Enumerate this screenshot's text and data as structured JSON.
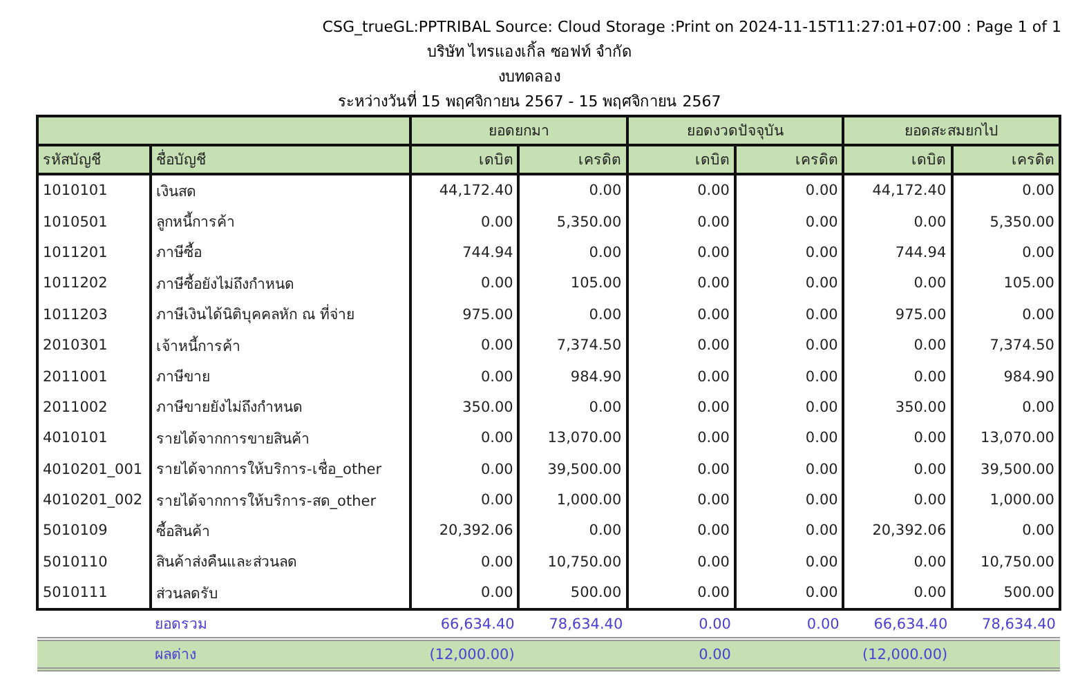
{
  "report_header": {
    "source_line": "CSG_trueGL:PPTRIBAL Source: Cloud Storage :Print on 2024-11-15T11:27:01+07:00 : Page 1 of 1",
    "company": "บริษัท ไทรแองเกิ้ล ซอฟท์ จำกัด",
    "title": "งบทดลอง",
    "period": "ระหว่างวันที่ 15 พฤศจิกายน 2567 - 15 พฤศจิกายน 2567"
  },
  "table": {
    "groups": [
      "ยอดยกมา",
      "ยอดงวดปัจจุบัน",
      "ยอดสะสมยกไป"
    ],
    "columns": [
      "รหัสบัญชี",
      "ชื่อบัญชี",
      "เดบิต",
      "เครดิต",
      "เดบิต",
      "เครดิต",
      "เดบิต",
      "เครดิต"
    ],
    "rows": [
      {
        "code": "1010101",
        "name": "เงินสด",
        "values": [
          "44,172.40",
          "0.00",
          "0.00",
          "0.00",
          "44,172.40",
          "0.00"
        ]
      },
      {
        "code": "1010501",
        "name": "ลูกหนี้การค้า",
        "values": [
          "0.00",
          "5,350.00",
          "0.00",
          "0.00",
          "0.00",
          "5,350.00"
        ]
      },
      {
        "code": "1011201",
        "name": "ภาษีซื้อ",
        "values": [
          "744.94",
          "0.00",
          "0.00",
          "0.00",
          "744.94",
          "0.00"
        ]
      },
      {
        "code": "1011202",
        "name": "ภาษีซื้อยังไม่ถึงกำหนด",
        "values": [
          "0.00",
          "105.00",
          "0.00",
          "0.00",
          "0.00",
          "105.00"
        ]
      },
      {
        "code": "1011203",
        "name": "ภาษีเงินได้นิติบุคคลหัก ณ ที่จ่าย",
        "values": [
          "975.00",
          "0.00",
          "0.00",
          "0.00",
          "975.00",
          "0.00"
        ]
      },
      {
        "code": "2010301",
        "name": "เจ้าหนี้การค้า",
        "values": [
          "0.00",
          "7,374.50",
          "0.00",
          "0.00",
          "0.00",
          "7,374.50"
        ]
      },
      {
        "code": "2011001",
        "name": "ภาษีขาย",
        "values": [
          "0.00",
          "984.90",
          "0.00",
          "0.00",
          "0.00",
          "984.90"
        ]
      },
      {
        "code": "2011002",
        "name": "ภาษีขายยังไม่ถึงกำหนด",
        "values": [
          "350.00",
          "0.00",
          "0.00",
          "0.00",
          "350.00",
          "0.00"
        ]
      },
      {
        "code": "4010101",
        "name": "รายได้จากการขายสินค้า",
        "values": [
          "0.00",
          "13,070.00",
          "0.00",
          "0.00",
          "0.00",
          "13,070.00"
        ]
      },
      {
        "code": "4010201_001",
        "name": "รายได้จากการให้บริการ-เชื่อ_other",
        "values": [
          "0.00",
          "39,500.00",
          "0.00",
          "0.00",
          "0.00",
          "39,500.00"
        ]
      },
      {
        "code": "4010201_002",
        "name": "รายได้จากการให้บริการ-สด_other",
        "values": [
          "0.00",
          "1,000.00",
          "0.00",
          "0.00",
          "0.00",
          "1,000.00"
        ]
      },
      {
        "code": "5010109",
        "name": "ซื้อสินค้า",
        "values": [
          "20,392.06",
          "0.00",
          "0.00",
          "0.00",
          "20,392.06",
          "0.00"
        ]
      },
      {
        "code": "5010110",
        "name": "สินค้าส่งคืนและส่วนลด",
        "values": [
          "0.00",
          "10,750.00",
          "0.00",
          "0.00",
          "0.00",
          "10,750.00"
        ]
      },
      {
        "code": "5010111",
        "name": "ส่วนลดรับ",
        "values": [
          "0.00",
          "500.00",
          "0.00",
          "0.00",
          "0.00",
          "500.00"
        ]
      }
    ],
    "totals": {
      "label": "ยอดรวม",
      "values": [
        "66,634.40",
        "78,634.40",
        "0.00",
        "0.00",
        "66,634.40",
        "78,634.40"
      ]
    },
    "difference": {
      "label": "ผลต่าง",
      "values": [
        "(12,000.00)",
        "0.00",
        "(12,000.00)"
      ]
    }
  }
}
